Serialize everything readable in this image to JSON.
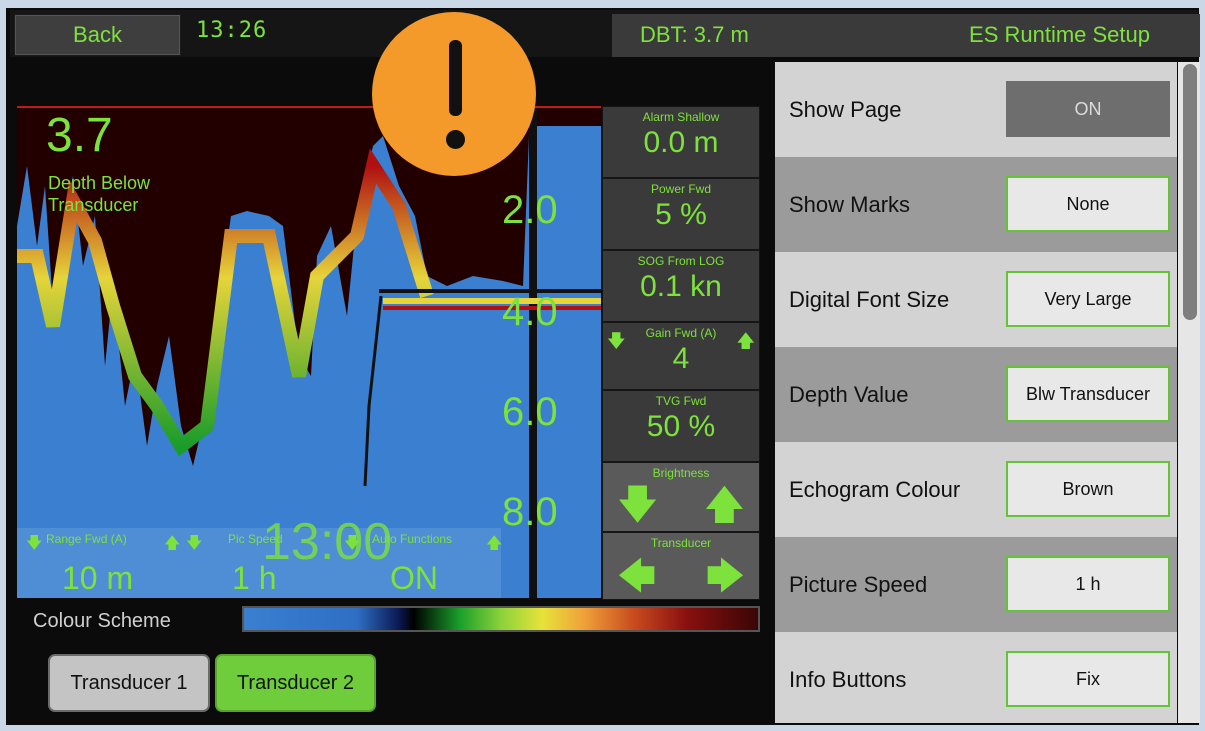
{
  "header": {
    "back_label": "Back",
    "clock": "13:26",
    "dbt": "DBT: 3.7 m",
    "page_title": "ES Runtime Setup"
  },
  "echogram": {
    "depth_value": "3.7",
    "depth_label_1": "Depth Below",
    "depth_label_2": "Transducer",
    "scale": [
      "2.0",
      "4.0",
      "6.0",
      "8.0"
    ],
    "overlay_time": "13:00"
  },
  "side_boxes": {
    "alarm_shallow": {
      "title": "Alarm Shallow",
      "value": "0.0 m"
    },
    "power_fwd": {
      "title": "Power Fwd",
      "value": "5 %"
    },
    "sog": {
      "title": "SOG From LOG",
      "value": "0.1 kn"
    },
    "gain_fwd": {
      "title": "Gain Fwd (A)",
      "value": "4"
    },
    "tvg_fwd": {
      "title": "TVG Fwd",
      "value": "50 %"
    },
    "brightness": {
      "title": "Brightness"
    },
    "transducer": {
      "title": "Transducer"
    }
  },
  "bottom_controls": {
    "range": {
      "title": "Range Fwd (A)",
      "value": "10 m"
    },
    "pic_speed": {
      "title": "Pic Speed",
      "value": "1 h"
    },
    "auto_functions": {
      "title": "Auto Functions",
      "value": "ON"
    }
  },
  "colour_scheme_label": "Colour Scheme",
  "transducer_buttons": [
    "Transducer 1",
    "Transducer 2"
  ],
  "settings": [
    {
      "label": "Show Page",
      "value": "ON"
    },
    {
      "label": "Show Marks",
      "value": "None"
    },
    {
      "label": "Digital Font Size",
      "value": "Very Large"
    },
    {
      "label": "Depth Value",
      "value": "Blw Transducer"
    },
    {
      "label": "Echogram Colour",
      "value": "Brown"
    },
    {
      "label": "Picture Speed",
      "value": "1 h"
    },
    {
      "label": "Info Buttons",
      "value": "Fix"
    }
  ],
  "colors": {
    "accent": "#7de23c",
    "alert": "#f39a2b",
    "echo_blue": "#3a7fd0"
  }
}
